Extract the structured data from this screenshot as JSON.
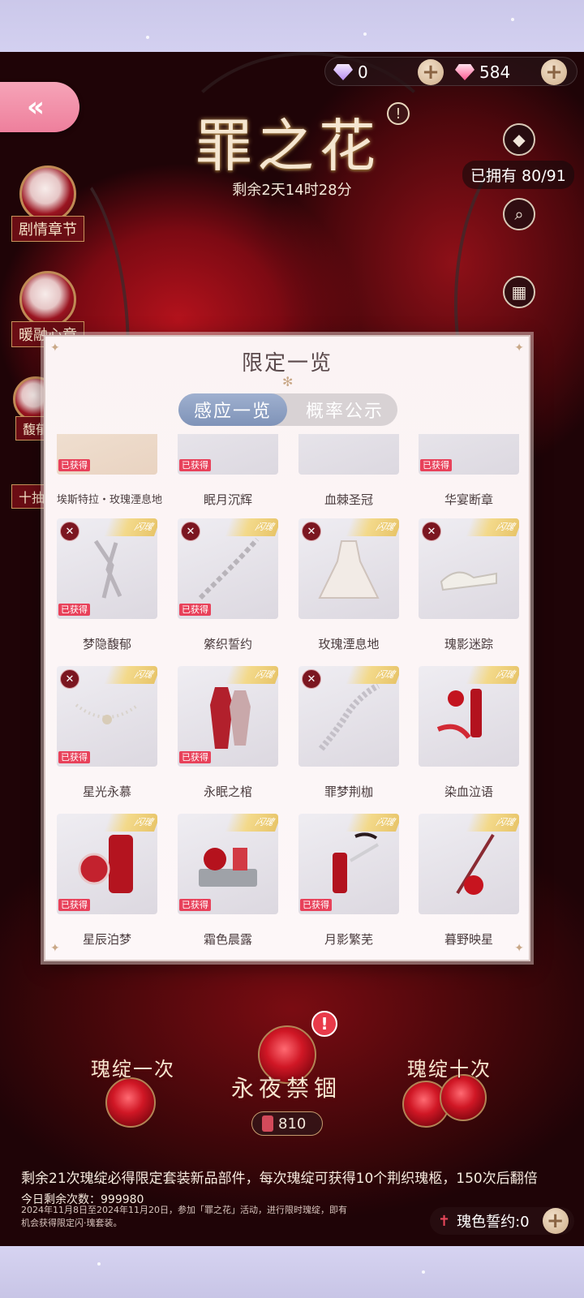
{
  "currency": {
    "diamond_purple": "0",
    "diamond_pink": "584",
    "add_symbol": "+"
  },
  "back_icon_glyph": "«",
  "event": {
    "title": "罪之花",
    "time_left": "剩余2天14时28分",
    "info_symbol": "!"
  },
  "side_menu": [
    {
      "label": "剧情章节"
    },
    {
      "label": "暖融心章"
    },
    {
      "label": "馥郁"
    },
    {
      "label": "十抽"
    }
  ],
  "right_menu": {
    "owned": "已拥有 80/91"
  },
  "panel": {
    "title": "限定一览",
    "tabs": [
      {
        "label": "感应一览",
        "active": true
      },
      {
        "label": "概率公示",
        "active": false
      }
    ],
    "obtained_label": "已获得",
    "badge_text": "闪瑰",
    "items": [
      {
        "name": "埃斯特拉・玫瑰湮息地",
        "obtained": true,
        "partial": true
      },
      {
        "name": "眠月沉辉",
        "obtained": true,
        "partial": true
      },
      {
        "name": "血棘圣冠",
        "obtained": false,
        "partial": true
      },
      {
        "name": "华宴断章",
        "obtained": true,
        "partial": true
      },
      {
        "name": "梦隐馥郁",
        "obtained": true
      },
      {
        "name": "綮织誓约",
        "obtained": true
      },
      {
        "name": "玫瑰湮息地",
        "obtained": false
      },
      {
        "name": "瑰影迷踪",
        "obtained": false
      },
      {
        "name": "星光永慕",
        "obtained": true
      },
      {
        "name": "永眠之棺",
        "obtained": true
      },
      {
        "name": "罪梦荆枷",
        "obtained": false
      },
      {
        "name": "染血泣语",
        "obtained": false
      },
      {
        "name": "星辰泊梦",
        "obtained": true
      },
      {
        "name": "霜色晨露",
        "obtained": true
      },
      {
        "name": "月影繁芜",
        "obtained": true
      },
      {
        "name": "暮野映星",
        "obtained": false
      }
    ]
  },
  "bottom": {
    "pull_once": "瑰绽一次",
    "pull_ten": "瑰绽十次",
    "pool_name": "永夜禁锢",
    "cost": "810",
    "guarantee": "剩余21次瑰绽必得限定套装新品部件，每次瑰绽可获得10个荆织瑰柩，150次后翻倍",
    "today_left": "今日剩余次数：999980",
    "desc_line1": "2024年11月8日至2024年11月20日，参加「罪之花」活动，进行限时瑰绽，即有",
    "desc_line2": "机会获得限定闪·瑰套装。",
    "pact": "瑰色誓约:0"
  }
}
